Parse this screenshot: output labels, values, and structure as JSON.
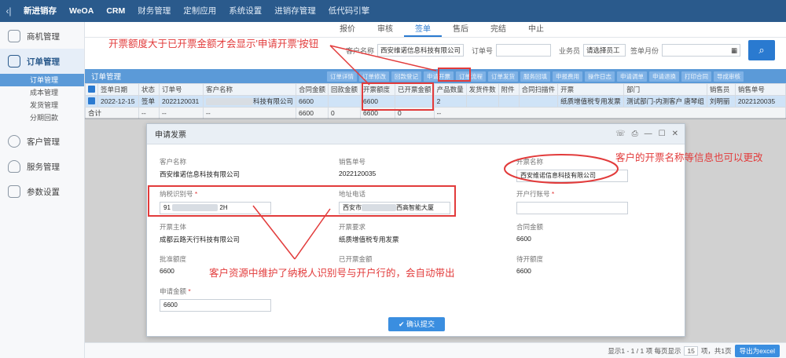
{
  "topnav": {
    "back_icon": "chevron-left-icon",
    "items": [
      "新进销存",
      "WeOA",
      "CRM",
      "财务管理",
      "定制应用",
      "系统设置",
      "进销存管理",
      "低代码引擎"
    ]
  },
  "sidebar": {
    "items": [
      {
        "label": "商机管理",
        "icon": "cube-icon"
      },
      {
        "label": "订单管理",
        "icon": "order-icon"
      },
      {
        "label": "客户管理",
        "icon": "user-icon"
      },
      {
        "label": "服务管理",
        "icon": "heart-icon"
      },
      {
        "label": "参数设置",
        "icon": "list-icon"
      }
    ],
    "subitems": [
      "订单管理",
      "成本管理",
      "发货管理",
      "分期回款"
    ]
  },
  "tabs": [
    "报价",
    "审核",
    "签单",
    "售后",
    "完结",
    "中止"
  ],
  "filter": {
    "customer_label": "客户名称",
    "customer_value": "西安维诺信息科技有限公司",
    "order_label": "订单号",
    "sales_label": "业务员",
    "sales_value": "请选择员工",
    "month_label": "签单月份",
    "search_icon": "search-icon"
  },
  "grid": {
    "title": "订单管理",
    "buttons": [
      "订单详情",
      "订单修改",
      "回款登记",
      "申请开票",
      "订单流程",
      "订单发货",
      "服务回填",
      "申报费用",
      "操作日志",
      "申请调单",
      "申请退换",
      "打印合同",
      "导成审核"
    ],
    "columns": [
      "签单日期",
      "状态",
      "订单号",
      "客户名称",
      "合同金额",
      "回款金额",
      "开票额度",
      "已开票金额",
      "产品数量",
      "发货件数",
      "附件",
      "合同扫描件",
      "开票",
      "部门",
      "销售员",
      "销售单号"
    ],
    "row": [
      "2022-12-15",
      "签单",
      "2022120031",
      "科技有限公司",
      "6600",
      "",
      "6600",
      "",
      "2",
      "",
      "",
      "",
      "纸质增值税专用发票",
      "测试部门-内测客户 唐琴组",
      "刘明丽",
      "2022120035"
    ],
    "total": [
      "合计",
      "--",
      "--",
      "--",
      "--",
      "6600",
      "0",
      "6600",
      "0"
    ]
  },
  "annotations": {
    "top": "开票额度大于已开票金额才会显示'申请开票'按钮",
    "right": "客户的开票名称等信息也可以更改",
    "bottom": "客户资源中维护了纳税人识别号与开户行的，会自动带出"
  },
  "dialog": {
    "title": "申请发票",
    "customer_name_label": "客户名称",
    "customer_name": "西安维诺信息科技有限公司",
    "sales_no_label": "销售单号",
    "sales_no": "2022120035",
    "invoice_name_label": "开票名称",
    "invoice_name": "西安维诺信息科技有限公司",
    "tax_id_label": "纳税识别号",
    "tax_id_prefix": "91",
    "tax_id_suffix": "2H",
    "address_label": "地址电话",
    "address_prefix": "西安市",
    "address_suffix": "西高智能大厦",
    "bank_label": "开户行账号",
    "subject_label": "开票主体",
    "subject": "成都云路天行科技有限公司",
    "req_label": "开票要求",
    "req": "纸质增值税专用发票",
    "contract_label": "合同金额",
    "contract": "6600",
    "approved_label": "批准额度",
    "approved": "6600",
    "invoiced_label": "已开票金额",
    "pending_label": "待开额度",
    "pending": "6600",
    "apply_label": "申请金额",
    "apply": "6600",
    "confirm": "确认提交"
  },
  "footer": {
    "info": "显示1 - 1 / 1 项  每页显示",
    "per_page": "15",
    "tail": "项，共1页",
    "export": "导出为excel"
  },
  "colors": {
    "nav": "#2a5a8c",
    "accent": "#2a7ad0",
    "annotation": "#e23b3b"
  }
}
